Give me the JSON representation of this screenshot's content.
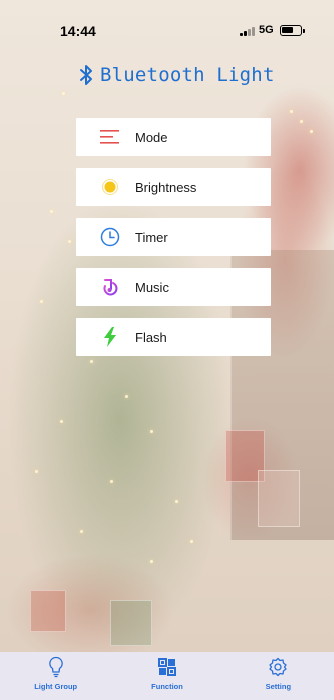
{
  "status_bar": {
    "time": "14:44",
    "network": "5G"
  },
  "header": {
    "title": "Bluetooth Light",
    "icon": "bluetooth-icon",
    "color": "#1f6fd1"
  },
  "menu": {
    "items": [
      {
        "label": "Mode",
        "icon": "menu-lines-icon",
        "color": "#e4524f"
      },
      {
        "label": "Brightness",
        "icon": "sun-icon",
        "color": "#f5c518"
      },
      {
        "label": "Timer",
        "icon": "clock-icon",
        "color": "#2d7de0"
      },
      {
        "label": "Music",
        "icon": "music-icon",
        "color": "#b146e8"
      },
      {
        "label": "Flash",
        "icon": "lightning-icon",
        "color": "#3fcc3f"
      }
    ]
  },
  "tabbar": {
    "accent": "#2a6fd6",
    "tabs": [
      {
        "label": "Light Group",
        "icon": "lightbulb-icon"
      },
      {
        "label": "Function",
        "icon": "function-grid-icon"
      },
      {
        "label": "Setting",
        "icon": "gear-icon"
      }
    ]
  }
}
